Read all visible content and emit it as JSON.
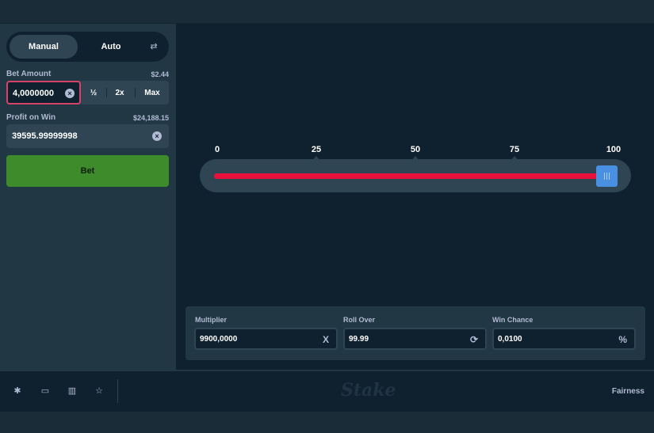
{
  "mode_toggle": {
    "manual": "Manual",
    "auto": "Auto",
    "swap_icon": "swap-icon"
  },
  "bet_amount": {
    "label": "Bet Amount",
    "usd_value": "$2.44",
    "value": "4,0000000",
    "half": "½",
    "double": "2x",
    "max": "Max"
  },
  "profit": {
    "label": "Profit on Win",
    "usd_value": "$24,188.15",
    "value": "39595.99999998"
  },
  "bet_button": "Bet",
  "slider": {
    "ticks": [
      "0",
      "25",
      "50",
      "75",
      "100"
    ],
    "value": 99.99,
    "track_color": "#e9113c",
    "handle_color": "#4a90e2"
  },
  "stats": {
    "multiplier": {
      "label": "Multiplier",
      "value": "9900,0000",
      "suffix": "X"
    },
    "roll_over": {
      "label": "Roll Over",
      "value": "99.99",
      "suffix_icon": "refresh-icon"
    },
    "win_chance": {
      "label": "Win Chance",
      "value": "0,0100",
      "suffix": "%"
    }
  },
  "footer": {
    "logo": "Stake",
    "fairness": "Fairness",
    "icons": [
      "gear-icon",
      "theater-icon",
      "chart-icon",
      "star-icon"
    ]
  },
  "colors": {
    "accent_green": "#3d8b2a",
    "panel": "#213743",
    "background": "#0f212e",
    "input_border_active": "#d6436a"
  }
}
